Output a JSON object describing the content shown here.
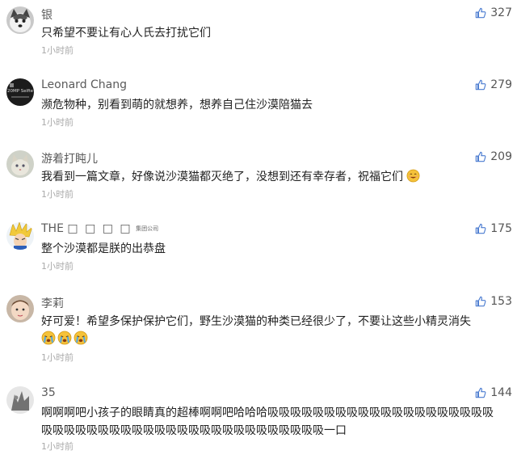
{
  "comments": [
    {
      "name": "银",
      "text": "只希望不要让有心人氏去打扰它们",
      "time": "1小时前",
      "likes": "327",
      "avatar": "husky-dog-avatar"
    },
    {
      "name": "Leonard Chang",
      "text": "濒危物种，别看到萌的就想养，想养自己住沙漠陪猫去",
      "time": "1小时前",
      "likes": "279",
      "avatar": "phone-camera-avatar",
      "avatar_text": "20MP Selfie"
    },
    {
      "name": "游着打盹儿",
      "text": "我看到一篇文章，好像说沙漠猫都灭绝了，没想到还有幸存者，祝福它们",
      "time": "1小时前",
      "likes": "209",
      "avatar": "cat-avatar",
      "emoji": "smile-emoji"
    },
    {
      "name": "THE",
      "name_suffix": "□ □ □ □",
      "name_small": "集团公司",
      "text": "整个沙漠都是朕的出恭盘",
      "time": "1小时前",
      "likes": "175",
      "avatar": "anime-character-avatar"
    },
    {
      "name": "李莉",
      "text": "好可爱！希望多保护保护它们，野生沙漠猫的种类已经很少了，不要让这些小精灵消失",
      "time": "1小时前",
      "likes": "153",
      "avatar": "baby-avatar",
      "emojis": [
        "crying-emoji",
        "crying-emoji",
        "crying-emoji"
      ]
    },
    {
      "name": "35",
      "text": "啊啊啊吧小孩子的眼睛真的超棒啊啊吧哈哈哈吸吸吸吸吸吸吸吸吸吸吸吸吸吸吸吸吸吸吸吸吸吸吸吸吸吸吸吸吸吸吸吸吸吸吸吸吸吸吸吸吸吸吸吸吸一口",
      "time": "1小时前",
      "likes": "144",
      "avatar": "cartoon-avatar"
    }
  ],
  "colors": {
    "name": "#5a5a5a",
    "time": "#aaaaaa",
    "thumb": "#4a7bd0",
    "emoji": "#f5c23a"
  }
}
